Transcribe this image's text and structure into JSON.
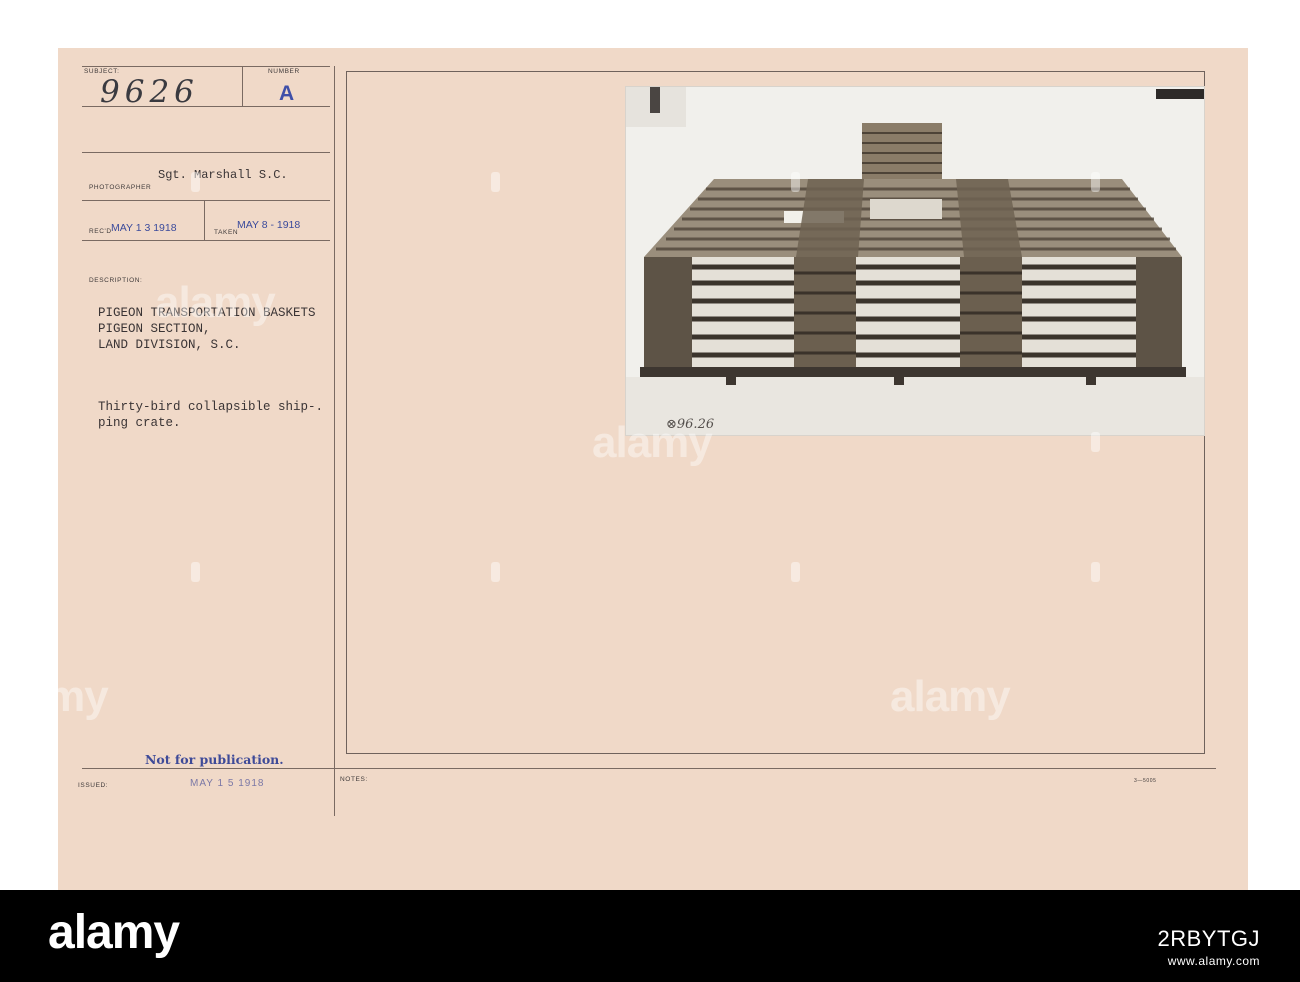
{
  "record": {
    "subject_label": "SUBJECT:",
    "subject_number": "9626",
    "number_label": "NUMBER",
    "number_letter": "A",
    "photographer_name": "Sgt. Marshall S.C.",
    "photographer_label": "PHOTOGRAPHER",
    "recd_label": "REC'D",
    "recd_date": "MAY 1 3 1918",
    "taken_label": "TAKEN",
    "taken_date": "MAY 8 - 1918",
    "description_label": "DESCRIPTION:",
    "description_lines": [
      "PIGEON TRANSPORTATION BASKETS",
      "PIGEON SECTION,",
      "LAND DIVISION, S.C."
    ],
    "caption_lines": [
      "Thirty-bird collapsible ship-.",
      "ping crate."
    ],
    "not_for_publication": "Not for publication.",
    "issued_label": "ISSUED:",
    "issued_date": "MAY 1 5 1918",
    "notes_label": "NOTES:",
    "form_code": "3—5005"
  },
  "photo": {
    "negative_number": "⊗96.26",
    "subject": "wicker pigeon shipping crate with small basket on top"
  },
  "watermark": {
    "text": "alamy"
  },
  "footer": {
    "logo": "alamy",
    "image_id": "2RBYTGJ",
    "url": "www.alamy.com"
  },
  "colors": {
    "card": "#f0d9c8",
    "stamp_blue": "#3f4fa8",
    "footer": "#000000"
  }
}
